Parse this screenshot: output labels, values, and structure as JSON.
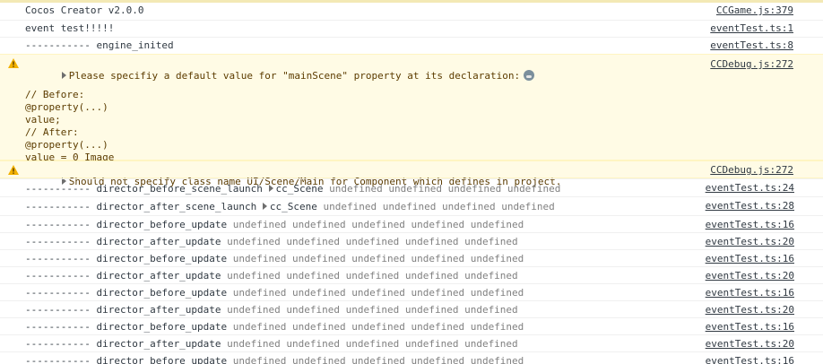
{
  "rows": [
    {
      "text": "Cocos Creator v2.0.0",
      "source": "CCGame.js:379"
    },
    {
      "text": "event test!!!!!",
      "source": "eventTest.ts:1"
    },
    {
      "text": "----------- engine_inited",
      "source": "eventTest.ts:8"
    }
  ],
  "warning1": {
    "text": "Please specifiy a default value for \"mainScene\" property at its declaration:",
    "source": "CCDebug.js:272",
    "code": "// Before:\n@property(...)\nvalue;\n// After:\n@property(...)\nvalue = 0 Image"
  },
  "warning2": {
    "text": "Should not specify class name UI/Scene/Main for Component which defines in project.",
    "source": "CCDebug.js:272"
  },
  "logs": [
    {
      "text": "----------- director_before_scene_launch",
      "obj": "cc_Scene",
      "rest": "undefined undefined undefined undefined",
      "source": "eventTest.ts:24"
    },
    {
      "text": "----------- director_after_scene_launch",
      "obj": "cc_Scene",
      "rest": "undefined undefined undefined undefined",
      "source": "eventTest.ts:28"
    },
    {
      "text": "----------- director_before_update",
      "rest": "undefined undefined undefined undefined undefined",
      "source": "eventTest.ts:16"
    },
    {
      "text": "----------- director_after_update",
      "rest": "undefined undefined undefined undefined undefined",
      "source": "eventTest.ts:20"
    },
    {
      "text": "----------- director_before_update",
      "rest": "undefined undefined undefined undefined undefined",
      "source": "eventTest.ts:16"
    },
    {
      "text": "----------- director_after_update",
      "rest": "undefined undefined undefined undefined undefined",
      "source": "eventTest.ts:20"
    },
    {
      "text": "----------- director_before_update",
      "rest": "undefined undefined undefined undefined undefined",
      "source": "eventTest.ts:16"
    },
    {
      "text": "----------- director_after_update",
      "rest": "undefined undefined undefined undefined undefined",
      "source": "eventTest.ts:20"
    },
    {
      "text": "----------- director_before_update",
      "rest": "undefined undefined undefined undefined undefined",
      "source": "eventTest.ts:16"
    },
    {
      "text": "----------- director_after_update",
      "rest": "undefined undefined undefined undefined undefined",
      "source": "eventTest.ts:20"
    },
    {
      "text": "----------- director_before_update",
      "rest": "undefined undefined undefined undefined undefined",
      "source": "eventTest.ts:16"
    }
  ],
  "icons": {
    "warning": "warning-triangle-icon",
    "expand": "expand-triangle-icon",
    "emoji": "fearful-face-emoji-icon"
  },
  "colors": {
    "warning_bg": "#fffbe5",
    "warning_icon": "#f2b100",
    "link": "#303942",
    "undefined_text": "#808080"
  }
}
